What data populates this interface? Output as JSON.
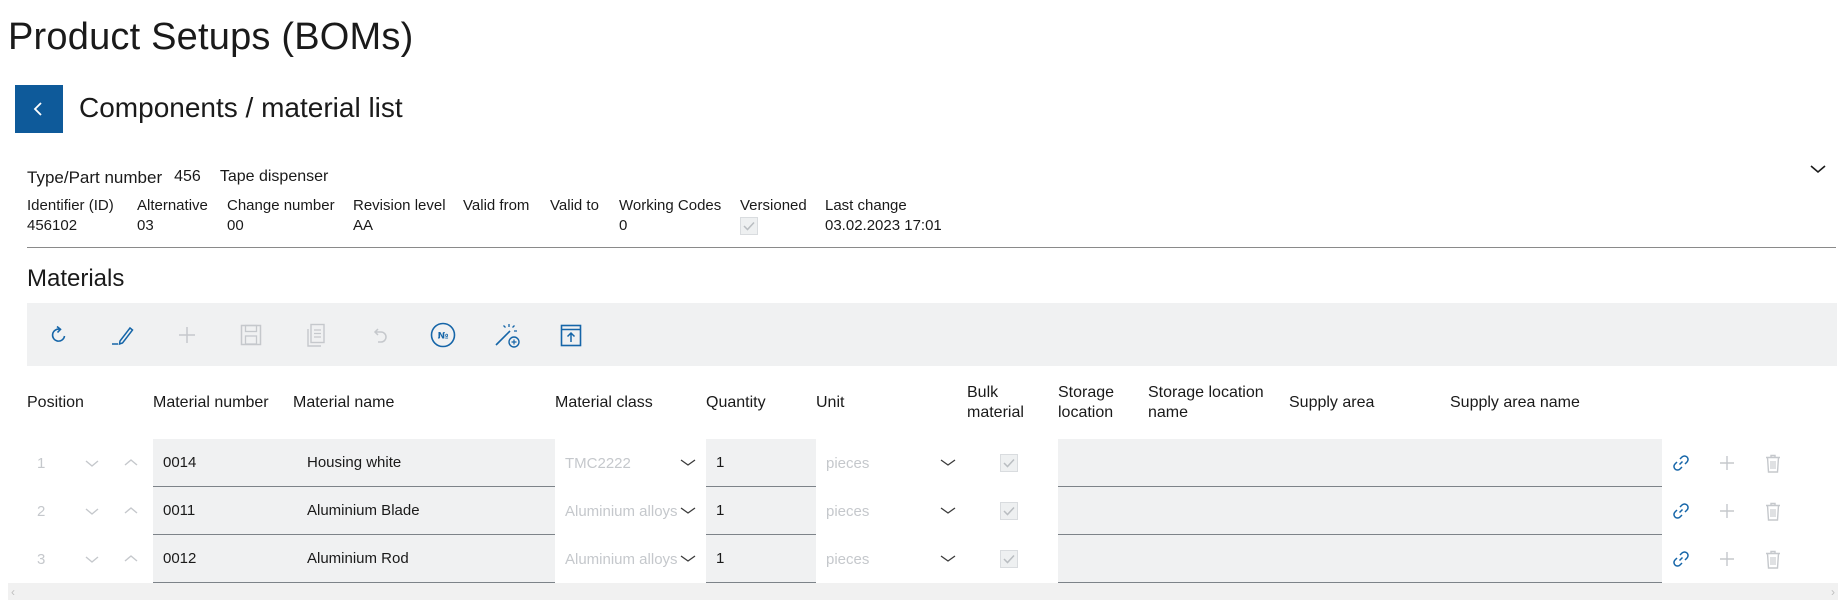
{
  "page": {
    "title": "Product Setups (BOMs)"
  },
  "header": {
    "back_label": "back",
    "subtitle": "Components / material list"
  },
  "part": {
    "label": "Type/Part number",
    "number": "456",
    "name": "Tape dispenser"
  },
  "meta": [
    {
      "key": "identifier",
      "label": "Identifier (ID)",
      "value": "456102"
    },
    {
      "key": "alternative",
      "label": "Alternative",
      "value": "03"
    },
    {
      "key": "change_number",
      "label": "Change number",
      "value": "00"
    },
    {
      "key": "revision_level",
      "label": "Revision level",
      "value": "AA"
    },
    {
      "key": "valid_from",
      "label": "Valid from",
      "value": ""
    },
    {
      "key": "valid_to",
      "label": "Valid to",
      "value": ""
    },
    {
      "key": "working_codes",
      "label": "Working Codes",
      "value": "0"
    },
    {
      "key": "versioned",
      "label": "Versioned",
      "value": "",
      "checked": true
    },
    {
      "key": "last_change",
      "label": "Last change",
      "value": "03.02.2023 17:01"
    }
  ],
  "materials": {
    "title": "Materials",
    "toolbar": [
      {
        "name": "refresh-icon",
        "enabled": true
      },
      {
        "name": "edit-icon",
        "enabled": true
      },
      {
        "name": "add-icon",
        "enabled": false
      },
      {
        "name": "save-icon",
        "enabled": false
      },
      {
        "name": "copy-icon",
        "enabled": false
      },
      {
        "name": "undo-icon",
        "enabled": false
      },
      {
        "name": "numbering-icon",
        "enabled": true
      },
      {
        "name": "magic-wand-add-icon",
        "enabled": true
      },
      {
        "name": "export-icon",
        "enabled": true
      }
    ],
    "columns": {
      "position": "Position",
      "material_number": "Material number",
      "material_name": "Material name",
      "material_class": "Material class",
      "quantity": "Quantity",
      "unit": "Unit",
      "bulk_material_1": "Bulk",
      "bulk_material_2": "material",
      "storage_location_1": "Storage",
      "storage_location_2": "location",
      "storage_location_name_1": "Storage location",
      "storage_location_name_2": "name",
      "supply_area": "Supply area",
      "supply_area_name": "Supply area name"
    },
    "rows": [
      {
        "position": "1",
        "material_number": "0014",
        "material_name": "Housing white",
        "material_class": "TMC2222",
        "quantity": "1",
        "unit": "pieces",
        "bulk": true
      },
      {
        "position": "2",
        "material_number": "0011",
        "material_name": "Aluminium Blade",
        "material_class": "Aluminium alloys",
        "quantity": "1",
        "unit": "pieces",
        "bulk": true
      },
      {
        "position": "3",
        "material_number": "0012",
        "material_name": "Aluminium Rod",
        "material_class": "Aluminium alloys",
        "quantity": "1",
        "unit": "pieces",
        "bulk": true
      }
    ]
  },
  "colors": {
    "accent": "#0e5a9a",
    "icon_blue": "#1565a8",
    "disabled": "#c5c8cc",
    "row_bg": "#f0f1f2"
  }
}
